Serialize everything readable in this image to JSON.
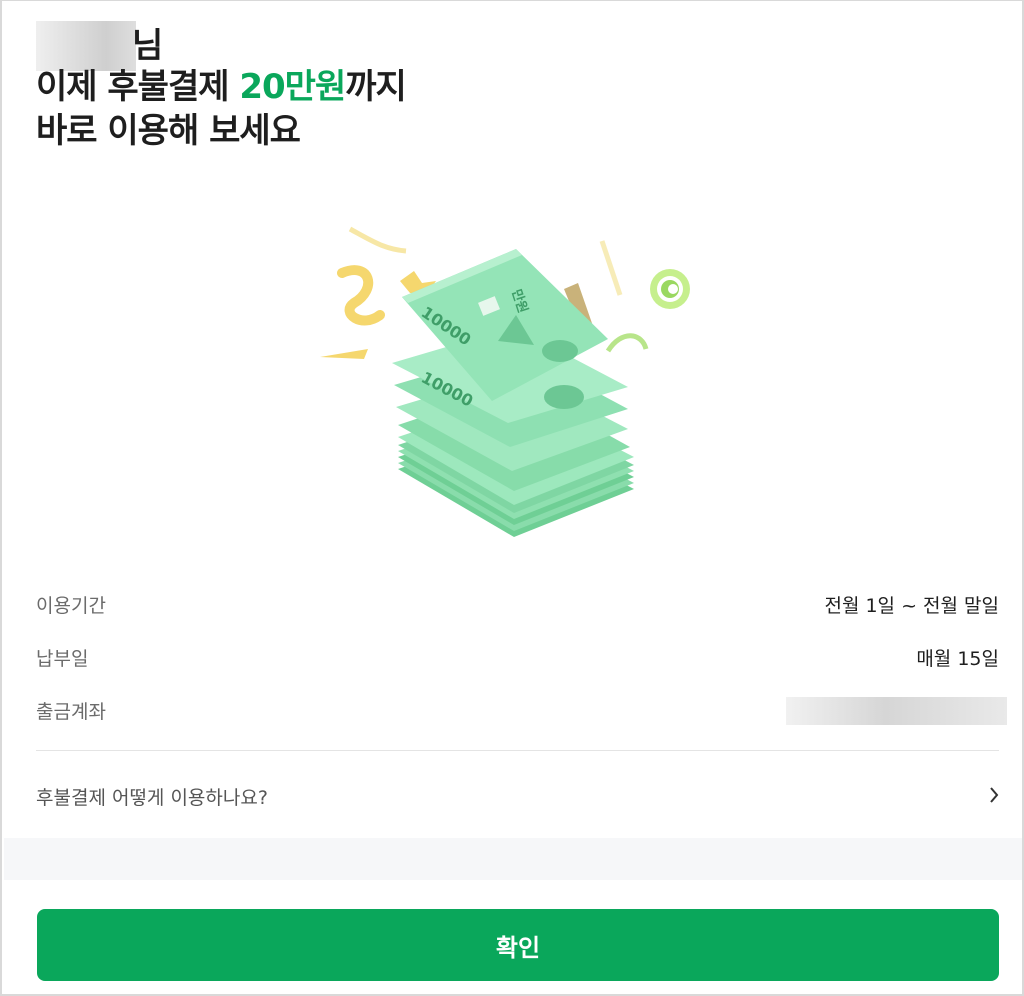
{
  "header": {
    "name_suffix": "님",
    "line2_prefix": "이제 후불결제 ",
    "line2_amount": "20만원",
    "line2_suffix": "까지",
    "line3": "바로 이용해 보세요"
  },
  "illustration": {
    "icon": "money-stack-icon",
    "banknote_denomination": "10000",
    "banknote_label": "만원"
  },
  "info": {
    "rows": [
      {
        "label": "이용기간",
        "value": "전월 1일 ~ 전월 말일"
      },
      {
        "label": "납부일",
        "value": "매월 15일"
      },
      {
        "label": "출금계좌",
        "value": ""
      }
    ]
  },
  "help": {
    "label": "후불결제 어떻게 이용하나요?",
    "icon": "chevron-right-icon"
  },
  "footer": {
    "confirm_label": "확인"
  },
  "colors": {
    "accent": "#0aa75b",
    "note_green": "#7fe0a8",
    "confetti_yellow": "#f5d76e"
  }
}
